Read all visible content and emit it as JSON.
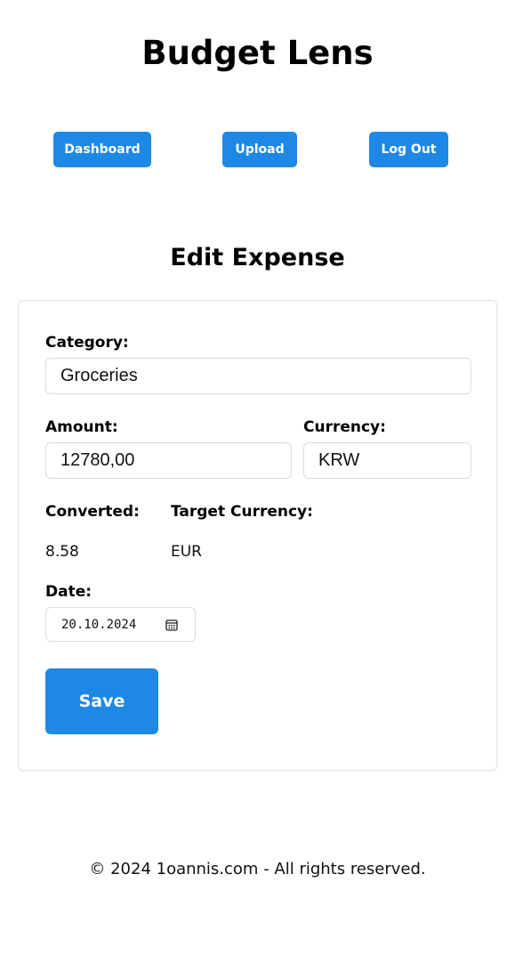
{
  "app": {
    "title": "Budget Lens"
  },
  "nav": {
    "dashboard": "Dashboard",
    "upload": "Upload",
    "logout": "Log Out"
  },
  "page": {
    "title": "Edit Expense"
  },
  "form": {
    "category_label": "Category:",
    "category_value": "Groceries",
    "amount_label": "Amount:",
    "amount_value": "12780,00",
    "currency_label": "Currency:",
    "currency_value": "KRW",
    "converted_label": "Converted:",
    "converted_value": "8.58",
    "target_currency_label": "Target Currency:",
    "target_currency_value": "EUR",
    "date_label": "Date:",
    "date_value": "20.10.2024",
    "save_label": "Save"
  },
  "footer": {
    "text": "© 2024 1oannis.com - All rights reserved."
  },
  "colors": {
    "accent": "#1e88e5",
    "card_border": "#e4e4e4",
    "field_border": "#dcdcdc"
  },
  "icons": {
    "date_picker": "calendar-icon"
  }
}
